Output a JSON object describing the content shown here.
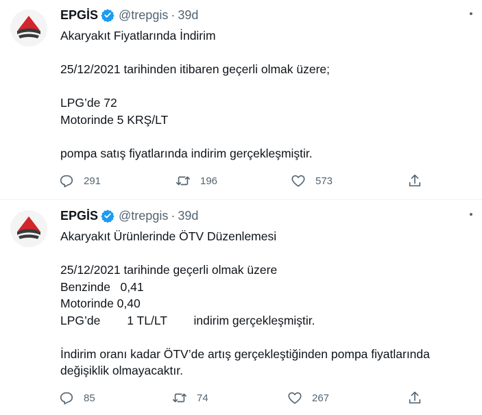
{
  "tweets": [
    {
      "name": "EPGİS",
      "handle": "@trepgis",
      "separator": "·",
      "time": "39d",
      "lines": [
        "Akaryakıt Fiyatlarında İndirim",
        "",
        "25/12/2021 tarihinden itibaren geçerli olmak üzere;",
        "",
        "LPG’de 72",
        "Motorinde 5 KRŞ/LT",
        "",
        "pompa satış fiyatlarında indirim gerçekleşmiştir."
      ],
      "replies": "291",
      "retweets": "196",
      "likes": "573"
    },
    {
      "name": "EPGİS",
      "handle": "@trepgis",
      "separator": "·",
      "time": "39d",
      "lines": [
        "Akaryakıt Ürünlerinde ÖTV Düzenlemesi",
        "",
        "25/12/2021 tarihinde geçerli olmak üzere",
        "Benzinde   0,41",
        "Motorinde 0,40",
        "LPG’de        1 TL/LT        indirim gerçekleşmiştir.",
        "",
        "İndirim oranı kadar ÖTV’de artış gerçekleştiğinden pompa fiyatlarında",
        "değişiklik olmayacaktır."
      ],
      "replies": "85",
      "retweets": "74",
      "likes": "267"
    }
  ],
  "colors": {
    "muted": "#536471",
    "verified": "#1d9bf0",
    "brand_red": "#d0262c",
    "brand_dark": "#3a3a3a"
  }
}
